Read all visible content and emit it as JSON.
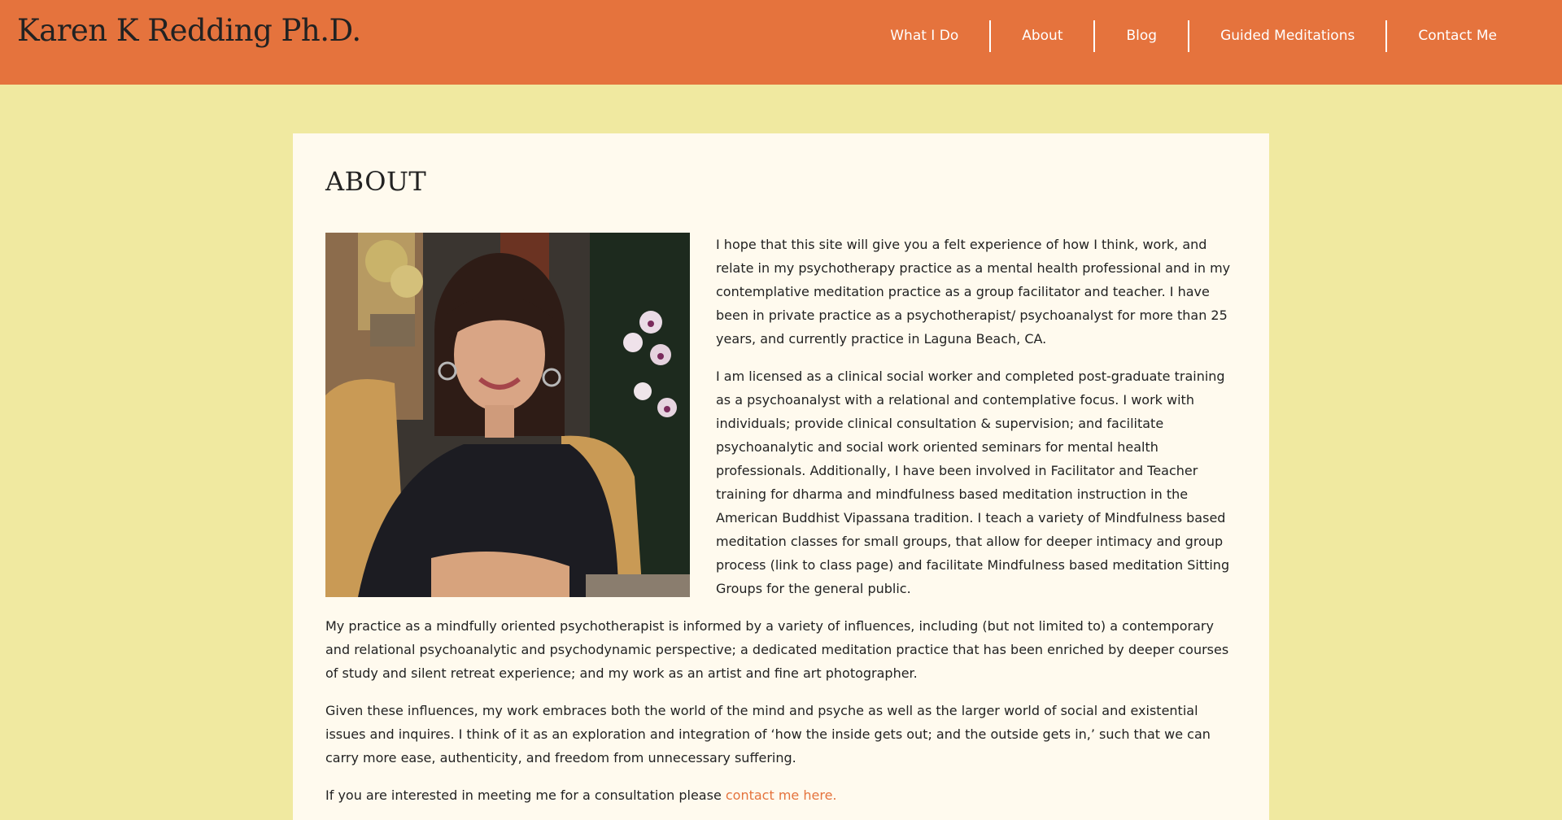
{
  "header": {
    "site_title": "Karen K Redding Ph.D.",
    "nav": [
      {
        "label": "What I Do"
      },
      {
        "label": "About"
      },
      {
        "label": "Blog"
      },
      {
        "label": "Guided Meditations"
      },
      {
        "label": "Contact Me"
      }
    ]
  },
  "main": {
    "title": "ABOUT",
    "photo_icon": "portrait-photo",
    "paragraphs": [
      "I hope that this site will give you a felt experience of how I think, work, and relate in my psychotherapy practice as a mental health professional and in my contemplative meditation practice as a group facilitator and teacher. I have been in private practice as a psychotherapist/ psychoanalyst for more than 25 years, and currently practice in Laguna Beach, CA.",
      "I am licensed as a clinical social worker and completed post-graduate training as a psychoanalyst with a relational and contemplative focus. I work with individuals; provide clinical consultation & supervision; and facilitate psychoanalytic and social work oriented seminars for mental health professionals. Additionally, I have been involved in Facilitator and Teacher training for dharma and mindfulness based meditation instruction in the American Buddhist Vipassana tradition. I  teach a variety of Mindfulness based meditation classes for small groups, that allow for deeper intimacy and group process (link to class page) and facilitate Mindfulness based meditation Sitting Groups for the general public.",
      "My practice as a mindfully oriented psychotherapist is informed by a variety of influences, including (but not limited to) a contemporary and relational psychoanalytic and psychodynamic perspective; a dedicated meditation practice that has been enriched by deeper courses of study and silent retreat experience; and my work as an artist and fine art photographer.",
      "Given these influences, my work embraces both the world of the mind and  psyche as well as the larger world of social and existential issues and inquires. I think of it as an exploration and integration of ‘how the inside gets out; and the outside gets in,’ such that we can carry more ease, authenticity, and freedom from unnecessary suffering."
    ],
    "contact_line": {
      "text": "If you are interested in meeting me for a consultation please ",
      "link_label": "contact me here."
    }
  },
  "colors": {
    "header_bg": "#e5733d",
    "page_bg": "#f0e9a0",
    "panel_bg": "#fffaee",
    "link": "#e5733d",
    "text": "#222222"
  }
}
